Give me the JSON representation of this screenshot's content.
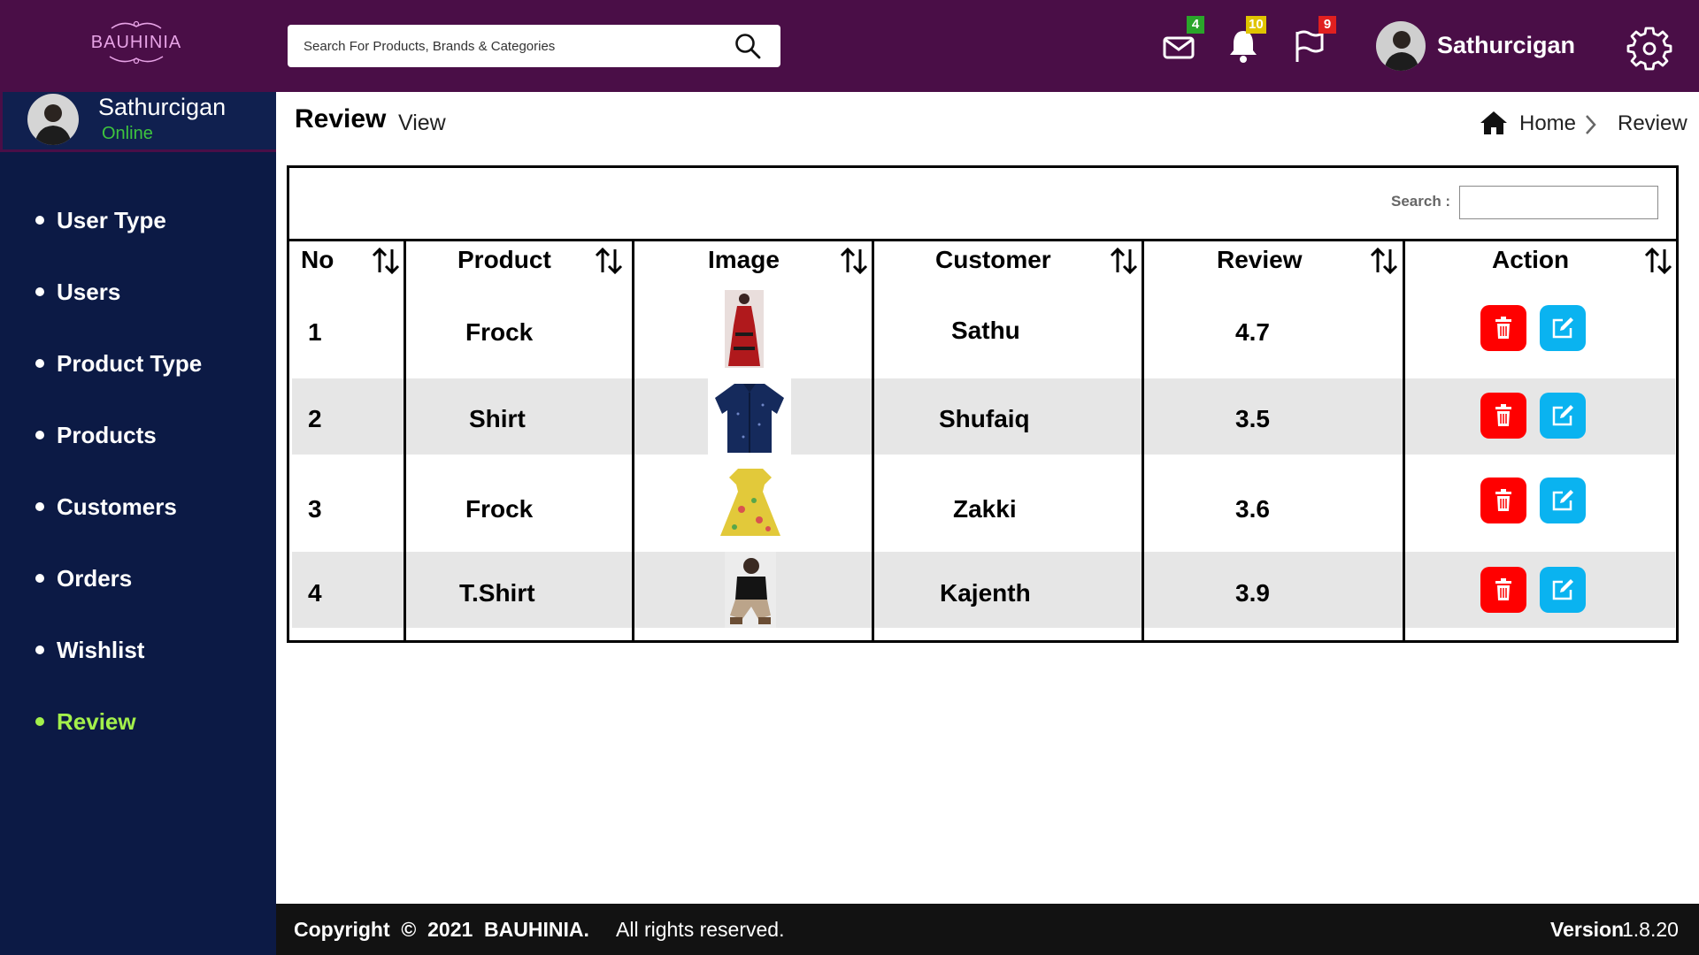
{
  "header": {
    "logo_text": "BAUHINIA",
    "search_placeholder": "Search For Products, Brands & Categories",
    "mail_count": "4",
    "notification_count": "10",
    "flag_count": "9",
    "user_name": "Sathurcigan",
    "colors": {
      "bar": "#4a0e47",
      "mail_badge": "#2aa52a",
      "notification_badge": "#e0c400",
      "flag_badge": "#e02020"
    }
  },
  "sidebar": {
    "user_name": "Sathurcigan",
    "status": "Online",
    "items": [
      {
        "label": "User Type",
        "active": false
      },
      {
        "label": "Users",
        "active": false
      },
      {
        "label": "Product Type",
        "active": false
      },
      {
        "label": "Products",
        "active": false
      },
      {
        "label": "Customers",
        "active": false
      },
      {
        "label": "Orders",
        "active": false
      },
      {
        "label": "Wishlist",
        "active": false
      },
      {
        "label": "Review",
        "active": true
      }
    ]
  },
  "page": {
    "title": "Review",
    "subtitle": "View",
    "breadcrumb": {
      "home": "Home",
      "current": "Review"
    }
  },
  "table": {
    "search_label": "Search :",
    "columns": [
      "No",
      "Product",
      "Image",
      "Customer",
      "Review",
      "Action"
    ],
    "rows": [
      {
        "no": "1",
        "product": "Frock",
        "image": "red-dress-photo",
        "customer": "Sathu",
        "review": "4.7"
      },
      {
        "no": "2",
        "product": "Shirt",
        "image": "navy-shirt-photo",
        "customer": "Shufaiq",
        "review": "3.5"
      },
      {
        "no": "3",
        "product": "Frock",
        "image": "yellow-frock-photo",
        "customer": "Zakki",
        "review": "3.6"
      },
      {
        "no": "4",
        "product": "T.Shirt",
        "image": "black-tshirt-photo",
        "customer": "Kajenth",
        "review": "3.9"
      }
    ],
    "action_icons": [
      "trash-icon",
      "edit-icon"
    ]
  },
  "footer": {
    "copyright": "Copyright  ©  2021  BAUHINIA.",
    "rights": "All rights reserved.",
    "version_label": "Version",
    "version_value": "1.8.20"
  }
}
